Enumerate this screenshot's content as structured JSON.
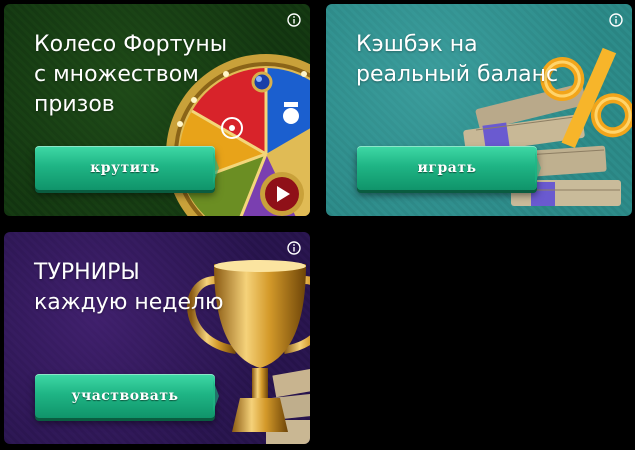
{
  "promos": {
    "wheel": {
      "title": "Колесо Фортуны\nс множеством\nпризов",
      "button_label": "крутить",
      "info_icon": "info-icon",
      "accent_color": "#143a12"
    },
    "cashback": {
      "title": "Кэшбэк на\nреальный баланс",
      "button_label": "играть",
      "info_icon": "info-icon",
      "accent_color": "#2b8886"
    },
    "tournament": {
      "title": "ТУРНИРЫ\nкаждую неделю",
      "button_label": "участвовать",
      "info_icon": "info-icon",
      "accent_color": "#28154d"
    }
  },
  "colors": {
    "button_top": "#3fd9a6",
    "button_bottom": "#10946a",
    "text": "#ffffff"
  }
}
